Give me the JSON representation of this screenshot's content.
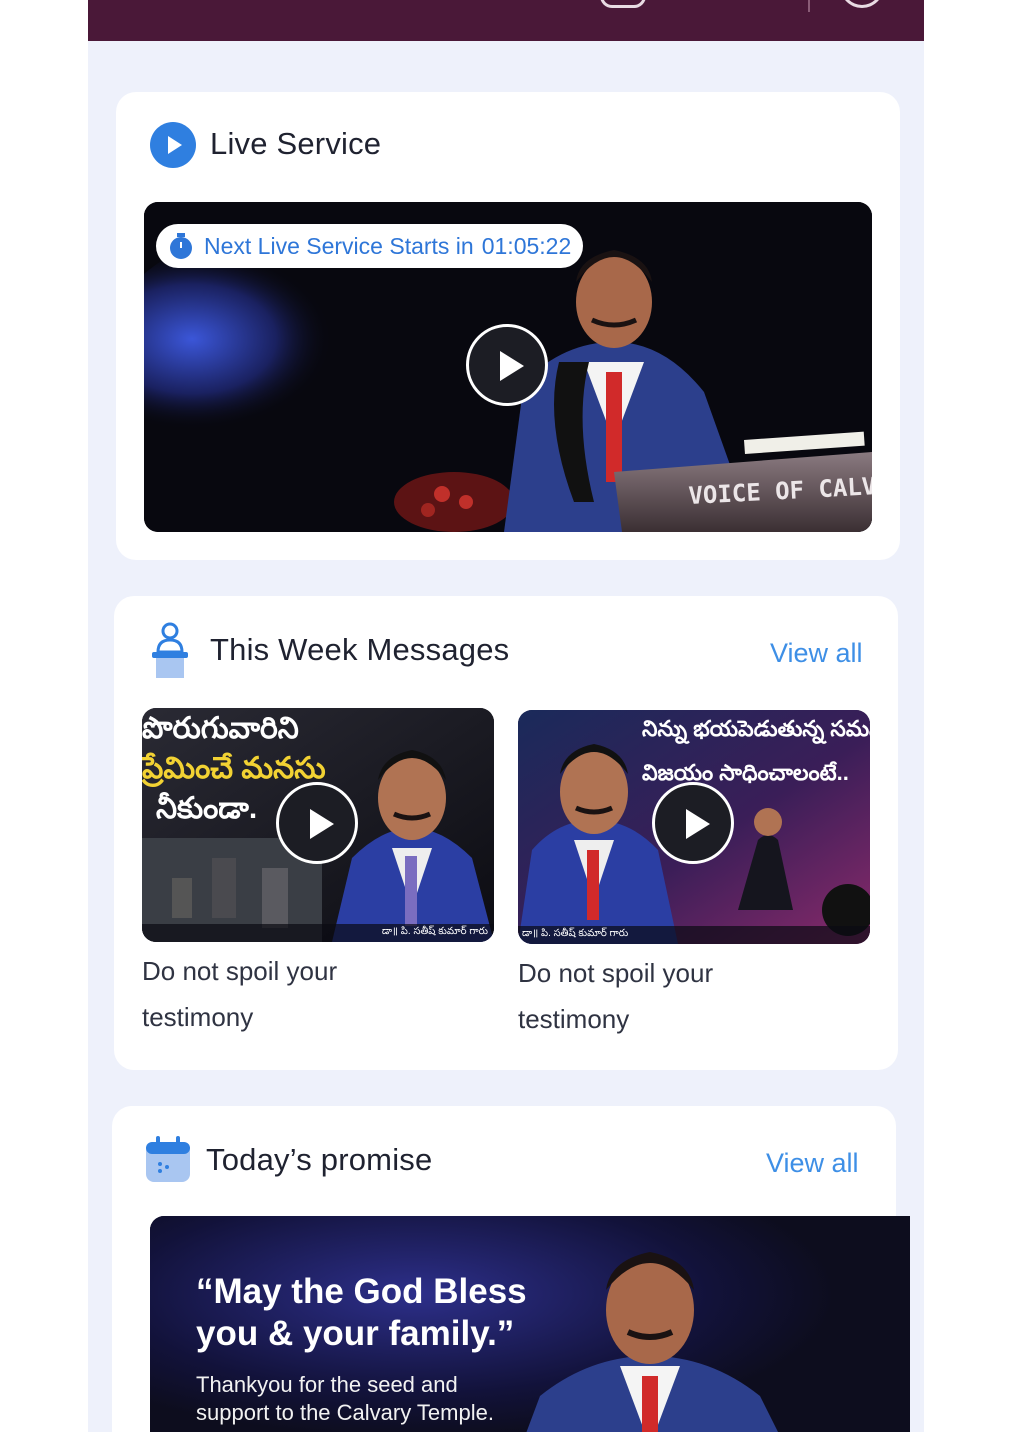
{
  "topbar": {
    "color": "#4a1838"
  },
  "live": {
    "title": "Live Service",
    "countdown_label": "Next Live Service Starts in",
    "countdown_time": "01:05:22",
    "podium_text": "VOICE OF CALVA"
  },
  "messages": {
    "title": "This Week Messages",
    "view_all": "View all",
    "items": [
      {
        "title_line1": "Do not spoil your",
        "title_line2": "testimony",
        "overlay_line1": "పొరుగువారిని",
        "overlay_line2": "ప్రేమించే మనసు",
        "overlay_line3": "నీకుండా.",
        "caption": "డా॥ పి. సతీష్ కుమార్ గారు"
      },
      {
        "title_line1": "Do not spoil your",
        "title_line2": "testimony",
        "overlay_line1": "నిన్ను భయపెడుతున్న సమస్య",
        "overlay_line2": "విజయం సాధించాలంటే..",
        "caption": "డా॥ పి. సతీష్ కుమార్ గారు"
      }
    ]
  },
  "promise": {
    "title": "Today’s promise",
    "view_all": "View all",
    "quote_line1": "“May the God Bless",
    "quote_line2": "you & your family.”",
    "sub_line1": "Thankyou for the seed and",
    "sub_line2": "support to the Calvary Temple."
  },
  "colors": {
    "accent": "#3e8fe6",
    "background": "#eef1fb",
    "card": "#ffffff"
  }
}
